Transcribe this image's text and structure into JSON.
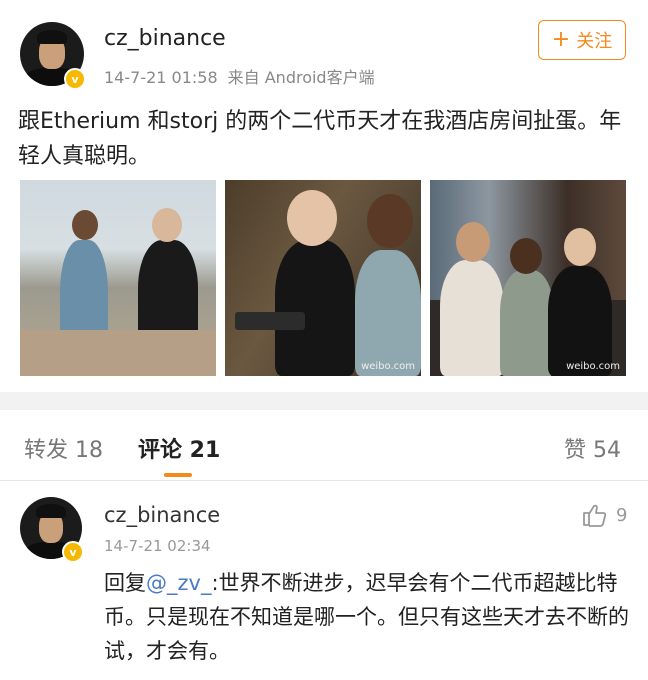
{
  "post": {
    "username": "cz_binance",
    "timestamp": "14-7-21 01:58",
    "source": "来自 Android客户端",
    "follow_label": "关注",
    "text": "跟Etherium 和storj 的两个二代币天才在我酒店房间扯蛋。年轻人真聪明。",
    "photos": [
      {
        "icon": "photo-outdoor-two-people"
      },
      {
        "icon": "photo-hotel-laptop"
      },
      {
        "icon": "photo-three-people-sofa",
        "watermark": "weibo.com"
      }
    ],
    "photo2_watermark": "weibo.com"
  },
  "tabs": {
    "repost": "转发 18",
    "comments": "评论 21",
    "likes": "赞 54"
  },
  "comment": {
    "username": "cz_binance",
    "timestamp": "14-7-21 02:34",
    "like_count": "9",
    "reply_prefix": "回复",
    "mention": "@_zv_",
    "text": ":世界不断进步，迟早会有个二代币超越比特币。只是现在不知道是哪一个。但只有这些天才去不断的试，才会有。"
  },
  "colors": {
    "accent": "#f28a1c",
    "verified_badge": "#f6b800",
    "mention": "#4a7ac8"
  }
}
